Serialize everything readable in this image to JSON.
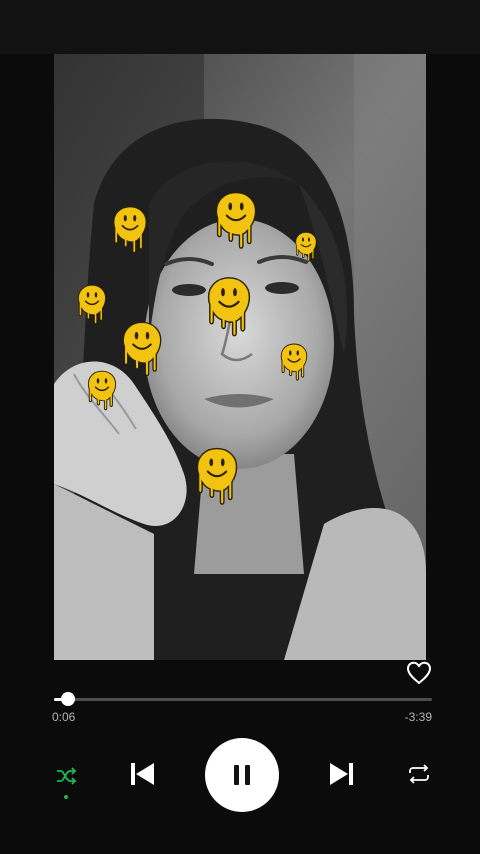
{
  "player": {
    "elapsed": "0:06",
    "remaining": "-3:39",
    "progress_fraction": 0.036,
    "liked": false,
    "state": "playing",
    "shuffle_active": true,
    "repeat_active": false
  },
  "colors": {
    "background": "#0b0b0b",
    "accent_green": "#1db954",
    "track": "#4d4d4d",
    "text_secondary": "#b3b3b3",
    "sticker_yellow": "#f2c411"
  },
  "icons": {
    "like": "heart-outline-icon",
    "shuffle": "shuffle-icon",
    "previous": "skip-previous-icon",
    "pause": "pause-icon",
    "next": "skip-next-icon",
    "repeat": "repeat-icon"
  }
}
